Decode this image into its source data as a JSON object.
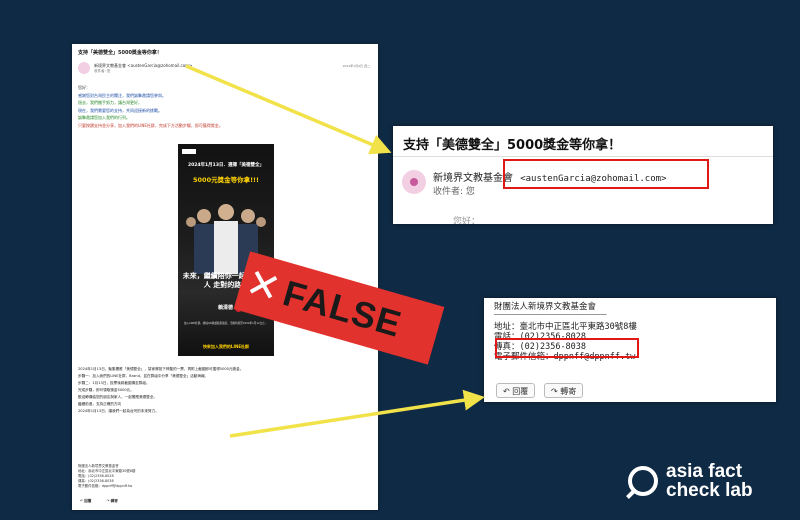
{
  "main": {
    "subject": "支持「美德雙全」5000獎金等你拿！",
    "sender": "新境界文教基金會",
    "sender_email": "<austenGarcia@zohomail.com>",
    "to": "收件者: 您",
    "date": "2024年1月9日 週二",
    "body_lines": [
      "您好：",
      "感謝您對台灣民主的關注，我們誠摯邀請您參與。",
      "過去，我們攜手努力，讓台灣更好。",
      "現在，我們需要您的支持，共同迎接新的挑戰。",
      "誠摯邀請您加入我們的行列。",
      "只要按讚支持並分享，加入我們的LINE社群，完成下方活動步驟，即可獲得獎金。"
    ],
    "poster": {
      "title": "2024年1月13日．選擇「美德雙全」",
      "prize": "5000元獎金等你拿!!!",
      "slogan": "未來，繼續陪你一起 選對的人 走對的路！",
      "vote": "賴清德",
      "vote_no": "2",
      "small": "加入LINE社群，掃描QR碼或點擊連結，活動時間至2024年1月12日止。",
      "join": "快來加入我們的LINE社群"
    },
    "body2_lines": [
      "2024年1月13日，聚集響應「美德雙全」，幫家鄉投下神聖的一票，再附上截圖即可獲得5000元獎金。",
      "步驟一：加入我們的LINE社群，Brand，並在群組中分享「美德雙全」活動海報。",
      "步驟二：1月13日，投票後將截圖傳至群組。",
      "完成步驟，即可領取獎金5000元。",
      "歡迎轉傳給您的朋友與家人，一起響應美德雙全。",
      "繼續前進，支持正確的方向",
      "2024年1月13日，讓我們一起為台灣的未來努力。"
    ],
    "signature_lines": [
      "財團法人新境界文教基金會",
      "地址：臺北市中正區北平東路30號8樓",
      "電話：(02)2356-8028",
      "傳真：(02)2356-8038",
      "電子郵件信箱：dppnff@dppnff.tw"
    ],
    "reply_label": "回覆",
    "forward_label": "轉寄"
  },
  "zoom_top": {
    "subject": "支持「美德雙全」5000獎金等你拿！",
    "sender": "新境界文教基金會",
    "sender_email": "<austenGarcia@zohomail.com>",
    "to": "收件者: 您",
    "cut_text": "您好："
  },
  "zoom_bottom": {
    "org": "財團法人新境界文教基金會",
    "dashes": "——————————————————————",
    "address": "地址：臺北市中正區北平東路30號8樓",
    "phone": "電話：(02)2356-8028",
    "fax": "傳真：(02)2356-8038",
    "email": "電子郵件信箱：dppnff@dppnff.tw",
    "reply_label": "回覆",
    "forward_label": "轉寄"
  },
  "stamp": {
    "text": "FALSE",
    "color": "#e2322e"
  },
  "logo": {
    "line1": "asia fact",
    "line2": "check lab"
  },
  "colors": {
    "background": "#0f2a44",
    "arrow": "#f2e24a",
    "highlight_box": "#e01818"
  }
}
